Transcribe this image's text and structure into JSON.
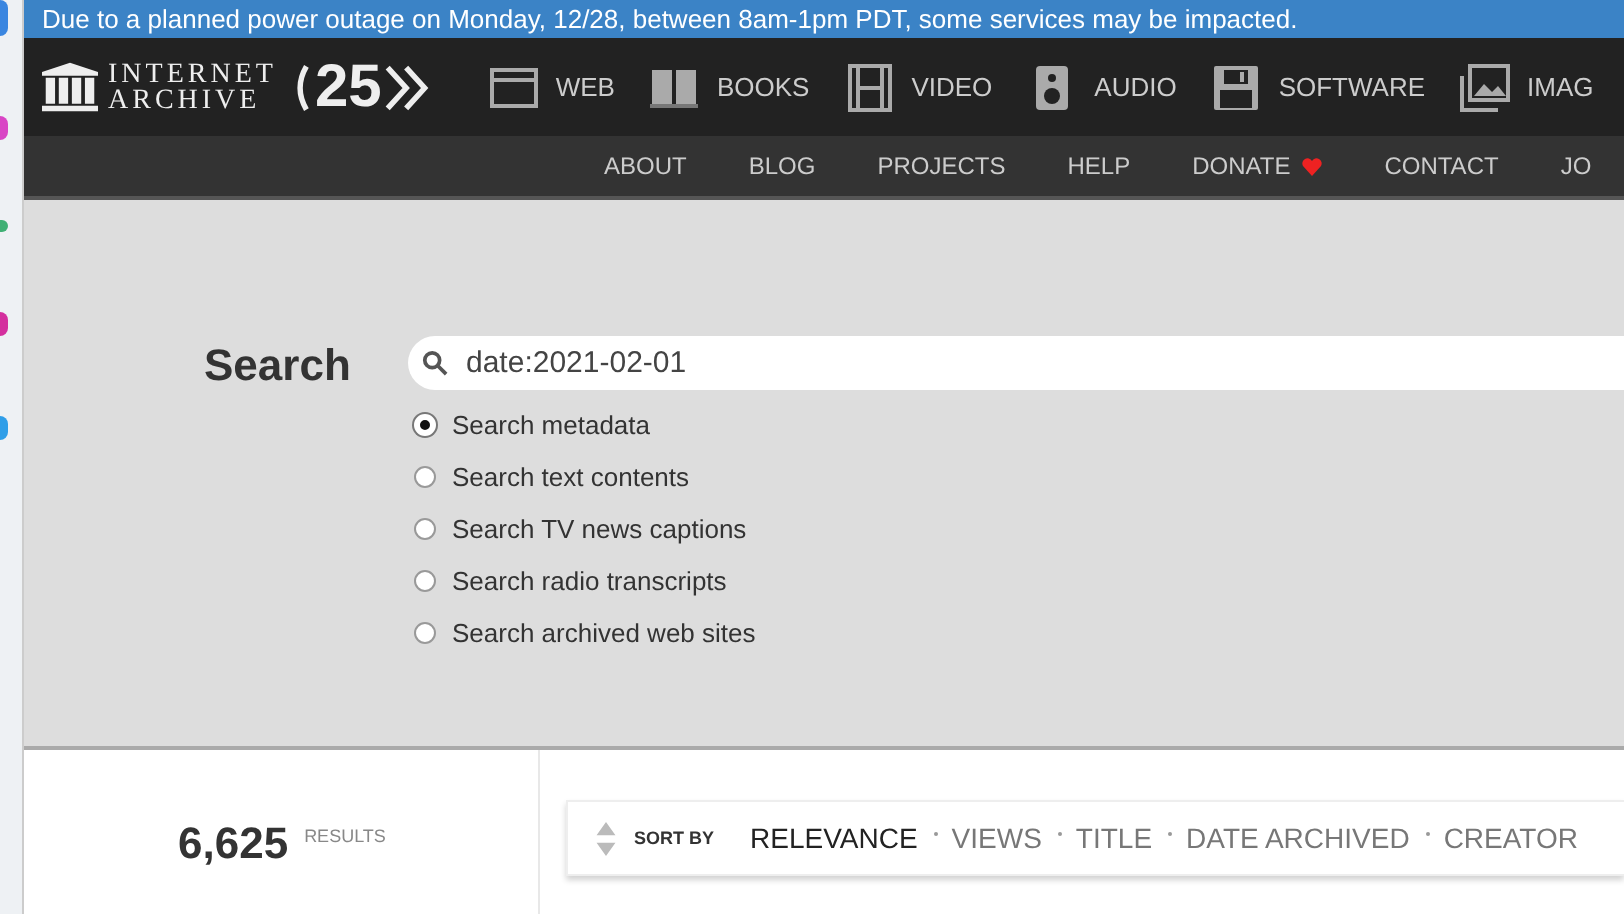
{
  "banner": {
    "text": "Due to a planned power outage on Monday, 12/28, between 8am-1pm PDT, some services may be impacted."
  },
  "logo": {
    "line_1": "INTERNET",
    "line_2": "ARCHIVE",
    "anniversary": "25"
  },
  "media_nav": [
    {
      "label": "WEB",
      "kind": "web"
    },
    {
      "label": "BOOKS",
      "kind": "books"
    },
    {
      "label": "VIDEO",
      "kind": "video"
    },
    {
      "label": "AUDIO",
      "kind": "audio"
    },
    {
      "label": "SOFTWARE",
      "kind": "software"
    },
    {
      "label": "IMAG",
      "kind": "images"
    }
  ],
  "sub_nav": [
    {
      "label": "ABOUT",
      "heart": false
    },
    {
      "label": "BLOG",
      "heart": false
    },
    {
      "label": "PROJECTS",
      "heart": false
    },
    {
      "label": "HELP",
      "heart": false
    },
    {
      "label": "DONATE",
      "heart": true
    },
    {
      "label": "CONTACT",
      "heart": false
    },
    {
      "label": "JO",
      "heart": false
    }
  ],
  "search": {
    "label": "Search",
    "value": "date:2021-02-01",
    "options": [
      {
        "label": "Search metadata",
        "selected": true
      },
      {
        "label": "Search text contents",
        "selected": false
      },
      {
        "label": "Search TV news captions",
        "selected": false
      },
      {
        "label": "Search radio transcripts",
        "selected": false
      },
      {
        "label": "Search archived web sites",
        "selected": false
      }
    ]
  },
  "results": {
    "count": "6,625",
    "unit": "RESULTS"
  },
  "sort": {
    "label": "SORT BY",
    "options": [
      {
        "label": "RELEVANCE",
        "selected": true
      },
      {
        "label": "VIEWS",
        "selected": false
      },
      {
        "label": "TITLE",
        "selected": false
      },
      {
        "label": "DATE ARCHIVED",
        "selected": false
      },
      {
        "label": "CREATOR",
        "selected": false
      }
    ]
  }
}
